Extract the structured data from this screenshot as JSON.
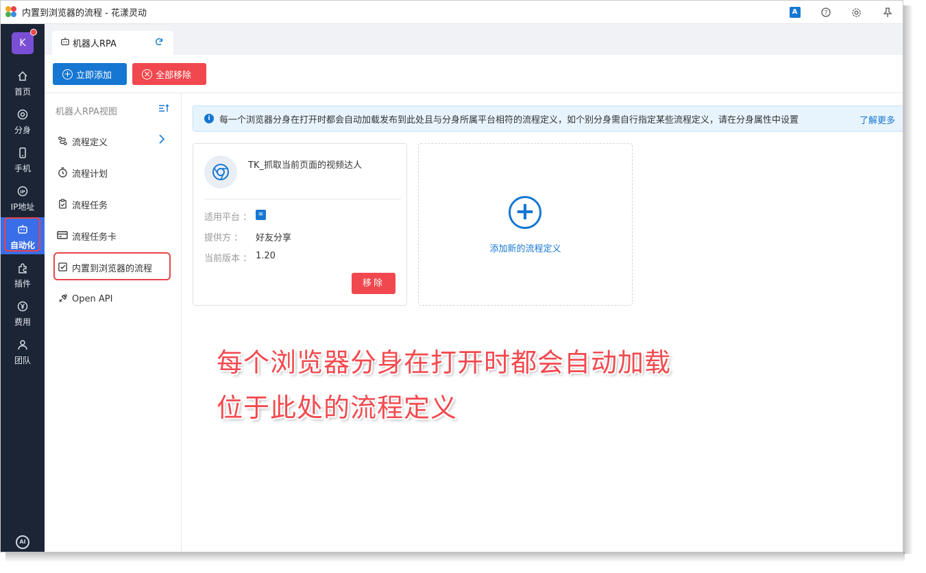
{
  "window": {
    "title": "内置到浏览器的流程 - 花漾灵动"
  },
  "titlebar_icons": [
    "translate-icon",
    "help-icon",
    "settings-icon",
    "pin-icon"
  ],
  "leftnav": {
    "avatar_letter": "K",
    "items": [
      {
        "label": "首页",
        "icon": "home-icon"
      },
      {
        "label": "分身",
        "icon": "browser-icon"
      },
      {
        "label": "手机",
        "icon": "phone-icon"
      },
      {
        "label": "IP地址",
        "icon": "ip-icon"
      },
      {
        "label": "自动化",
        "icon": "robot-icon",
        "active": true
      },
      {
        "label": "插件",
        "icon": "plugin-icon"
      },
      {
        "label": "费用",
        "icon": "yen-icon"
      },
      {
        "label": "团队",
        "icon": "team-icon"
      }
    ],
    "ai_badge": "AI"
  },
  "tabs": [
    {
      "label": "机器人RPA"
    }
  ],
  "toolbar": {
    "add_label": "立即添加",
    "remove_all_label": "全部移除"
  },
  "subnav": {
    "title": "机器人RPA视图",
    "items": [
      {
        "label": "流程定义",
        "icon": "flow-icon"
      },
      {
        "label": "流程计划",
        "icon": "timer-icon"
      },
      {
        "label": "流程任务",
        "icon": "clipboard-icon"
      },
      {
        "label": "流程任务卡",
        "icon": "card-icon"
      },
      {
        "label": "内置到浏览器的流程",
        "icon": "checkbox-icon",
        "active": true
      },
      {
        "label": "Open API",
        "icon": "api-icon"
      }
    ]
  },
  "notice": {
    "text": "每一个浏览器分身在打开时都会自动加载发布到此处且与分身所属平台相符的流程定义，如个别分身需自行指定某些流程定义，请在分身属性中设置",
    "link": "了解更多"
  },
  "flow_card": {
    "name": "TK_抓取当前页面的视频达人",
    "platform_label": "适用平台 ：",
    "provider_label": "提供方 ：",
    "provider_value": "好友分享",
    "version_label": "当前版本 ：",
    "version_value": "1.20",
    "remove_label": "移除"
  },
  "add_card": {
    "label": "添加新的流程定义"
  },
  "annotation": {
    "line1": "每个浏览器分身在打开时都会自动加载",
    "line2": "位于此处的流程定义"
  },
  "colors": {
    "primary": "#1677d2",
    "danger": "#f0484e",
    "nav_bg": "#1c2535",
    "highlight": "#e8424a"
  }
}
